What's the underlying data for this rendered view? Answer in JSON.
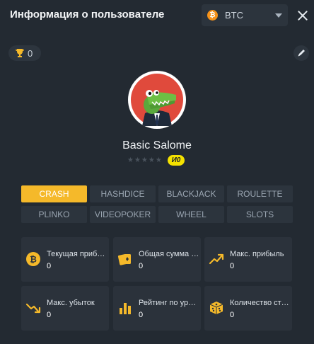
{
  "header": {
    "title": "Информация о пользователе",
    "currency": "BTC",
    "coin_symbol": "₿"
  },
  "trophy": {
    "count": "0"
  },
  "user": {
    "name": "Basic Salome",
    "stars": "★★★★★",
    "level": "И0"
  },
  "games": [
    {
      "label": "CRASH",
      "active": true
    },
    {
      "label": "HASHDICE",
      "active": false
    },
    {
      "label": "BLACKJACK",
      "active": false
    },
    {
      "label": "ROULETTE",
      "active": false
    },
    {
      "label": "PLINKO",
      "active": false
    },
    {
      "label": "VIDEOPOKER",
      "active": false
    },
    {
      "label": "WHEEL",
      "active": false
    },
    {
      "label": "SLOTS",
      "active": false
    }
  ],
  "stats": [
    {
      "label": "Текущая приб…",
      "value": "0",
      "icon": "bitcoin-icon"
    },
    {
      "label": "Общая сумма …",
      "value": "0",
      "icon": "cards-icon"
    },
    {
      "label": "Макс. прибыль",
      "value": "0",
      "icon": "trend-up-icon"
    },
    {
      "label": "Макс. убыток",
      "value": "0",
      "icon": "trend-down-icon"
    },
    {
      "label": "Рейтинг по уро…",
      "value": "0",
      "icon": "bar-chart-icon"
    },
    {
      "label": "Количество ст…",
      "value": "0",
      "icon": "dice-icon"
    }
  ],
  "colors": {
    "background": "#232a32",
    "accent": "#f5b92a",
    "level_badge": "#f5e200",
    "avatar_bg": "#e04a3c"
  }
}
